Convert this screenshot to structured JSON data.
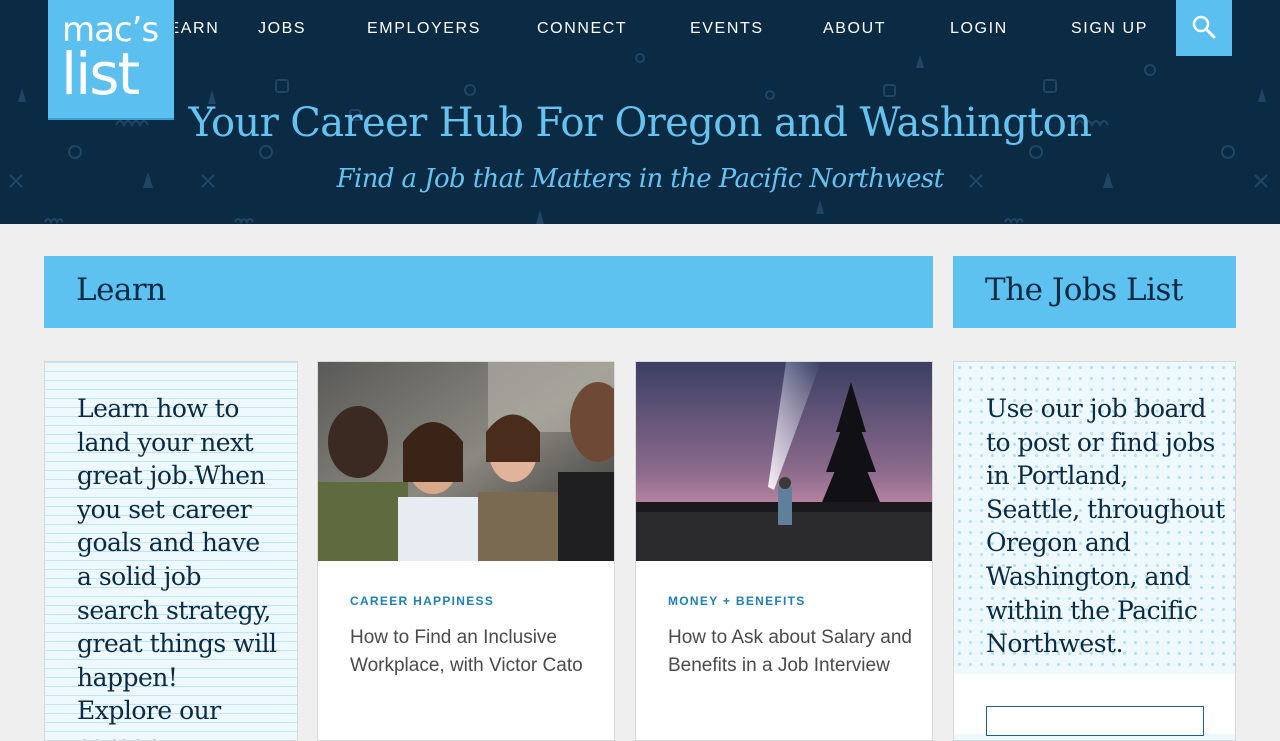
{
  "brand": {
    "logo_line1": "mac’s",
    "logo_line2": "list"
  },
  "nav": {
    "items": [
      {
        "label": "LEARN"
      },
      {
        "label": "JOBS"
      },
      {
        "label": "EMPLOYERS"
      },
      {
        "label": "CONNECT"
      },
      {
        "label": "EVENTS"
      },
      {
        "label": "ABOUT"
      },
      {
        "label": "LOGIN"
      },
      {
        "label": "SIGN UP"
      }
    ],
    "search_icon": "search-icon"
  },
  "hero": {
    "title": "Your Career Hub For Oregon and Washington",
    "subtitle": "Find a Job that Matters in the Pacific Northwest"
  },
  "learn": {
    "heading": "Learn",
    "intro": "Learn how to land your next great job.When you set career goals and have a solid job search strategy, great things will happen! Explore our career",
    "articles": [
      {
        "category": "CAREER HAPPINESS",
        "title": "How to Find an Inclusive Workplace, with Victor Cato"
      },
      {
        "category": "MONEY + BENEFITS",
        "title": "How to Ask about Salary and Benefits in a Job Interview"
      }
    ]
  },
  "jobs_list": {
    "heading": "The Jobs List",
    "text": "Use our job board to post or find jobs in Portland, Seattle, throughout Oregon and Washington, and within the Pacific Northwest."
  },
  "colors": {
    "header_bg": "#0b2a44",
    "accent": "#5ec2f1",
    "hero_text": "#66c3ef",
    "heading_text": "#0b2a44",
    "category_text": "#1f7fb5"
  }
}
